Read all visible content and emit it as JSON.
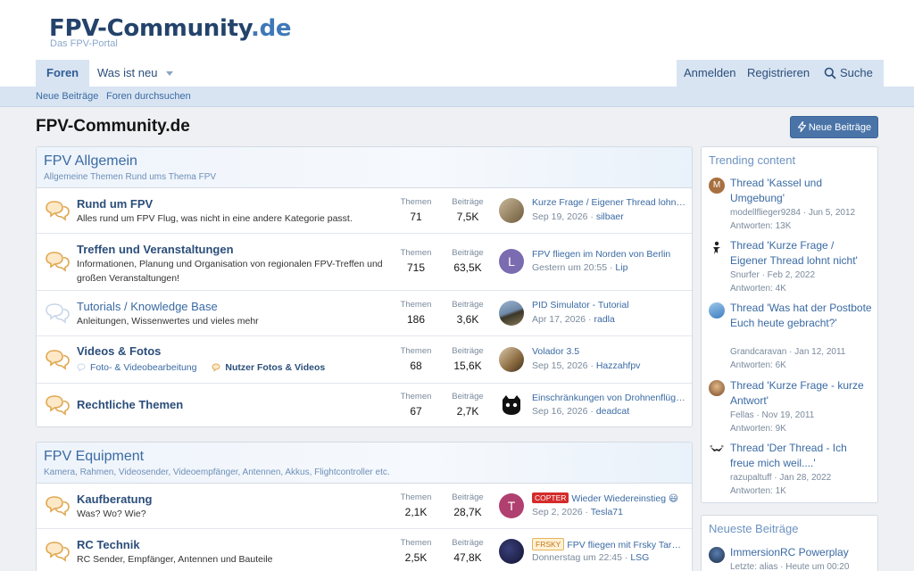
{
  "site": {
    "logo_main": "FPV-Community",
    "logo_tld": ".de",
    "logo_sub": "Das FPV-Portal"
  },
  "nav": {
    "foren": "Foren",
    "was_ist_neu": "Was ist neu",
    "anmelden": "Anmelden",
    "registrieren": "Registrieren",
    "suche": "Suche"
  },
  "subnav": {
    "neue_beitraege": "Neue Beiträge",
    "foren_durchsuchen": "Foren durchsuchen"
  },
  "page": {
    "title": "FPV-Community.de",
    "new_posts_button": "Neue Beiträge"
  },
  "labels": {
    "themen": "Themen",
    "beitraege": "Beiträge"
  },
  "categories": [
    {
      "title": "FPV Allgemein",
      "description": "Allgemeine Themen Rund ums Thema FPV",
      "forums": [
        {
          "title": "Rund um FPV",
          "description": "Alles rund um FPV Flug, was nicht in eine andere Kategorie passt.",
          "themen": "71",
          "beitraege": "7,5K",
          "last_title": "Kurze Frage / Eigener Thread lohnt nicht",
          "last_date": "Sep 19, 2026",
          "last_user": "silbaer"
        },
        {
          "title": "Treffen und Veranstaltungen",
          "description": "Informationen, Planung und Organisation von regionalen FPV-Treffen und großen Veranstaltungen!",
          "themen": "715",
          "beitraege": "63,5K",
          "last_title": "FPV fliegen im Norden von Berlin",
          "last_date": "Gestern um 20:55",
          "last_user": "Lip",
          "avatar_letter": "L"
        },
        {
          "title": "Tutorials / Knowledge Base",
          "description": "Anleitungen, Wissenwertes und vieles mehr",
          "themen": "186",
          "beitraege": "3,6K",
          "last_title": "PID Simulator - Tutorial",
          "last_date": "Apr 17, 2026",
          "last_user": "radla"
        },
        {
          "title": "Videos & Fotos",
          "sub_forums": [
            "Foto- & Videobearbeitung",
            "Nutzer Fotos & Videos"
          ],
          "themen": "68",
          "beitraege": "15,6K",
          "last_title": "Volador 3.5",
          "last_date": "Sep 15, 2026",
          "last_user": "Hazzahfpv"
        },
        {
          "title": "Rechtliche Themen",
          "themen": "67",
          "beitraege": "2,7K",
          "last_title": "Einschränkungen von Drohnenflügen",
          "last_date": "Sep 16, 2026",
          "last_user": "deadcat"
        }
      ]
    },
    {
      "title": "FPV Equipment",
      "description": "Kamera, Rahmen, Videosender, Videoempfänger, Antennen, Akkus, Flightcontroller etc.",
      "forums": [
        {
          "title": "Kaufberatung",
          "description": "Was? Wo? Wie?",
          "themen": "2,1K",
          "beitraege": "28,7K",
          "last_prefix": "COPTER",
          "last_title": "Wieder Wiedereinstieg 😃",
          "last_date": "Sep 2, 2026",
          "last_user": "Tesla71",
          "avatar_letter": "T"
        },
        {
          "title": "RC Technik",
          "description": "RC Sender, Empfänger, Antennen und Bauteile",
          "themen": "2,5K",
          "beitraege": "47,8K",
          "last_prefix": "FRSKY",
          "last_title": "FPV fliegen mit Frsky Taranis",
          "last_date": "Donnerstag um 22:45",
          "last_user": "LSG"
        }
      ]
    }
  ],
  "trending": {
    "title": "Trending content",
    "items": [
      {
        "title": "Thread 'Kassel und Umgebung'",
        "meta": "modellflieger9284 · Jun 5, 2012",
        "replies": "Antworten: 13K",
        "avatar_letter": "M"
      },
      {
        "title": "Thread 'Kurze Frage / Eigener Thread lohnt nicht'",
        "meta": "Snurfer · Feb 2, 2022",
        "replies": "Antworten: 4K"
      },
      {
        "title": "Thread 'Was hat der Postbote Euch heute gebracht?'",
        "meta": "Grandcaravan · Jan 12, 2011",
        "replies": "Antworten: 6K"
      },
      {
        "title": "Thread 'Kurze Frage - kurze Antwort'",
        "meta": "Fellas · Nov 19, 2011",
        "replies": "Antworten: 9K"
      },
      {
        "title": "Thread 'Der Thread - Ich freue mich weil....'",
        "meta": "razupaltuff · Jan 28, 2022",
        "replies": "Antworten: 1K"
      }
    ]
  },
  "newest": {
    "title": "Neueste Beiträge",
    "items": [
      {
        "title": "ImmersionRC Powerplay",
        "meta": "Letzte: alias · Heute um 00:20"
      }
    ]
  },
  "colors": {
    "accent": "#3a6aa3",
    "nav_bg": "#d8e4f2",
    "button": "#4a74a8",
    "prefix_copter": "#d42b2b"
  }
}
